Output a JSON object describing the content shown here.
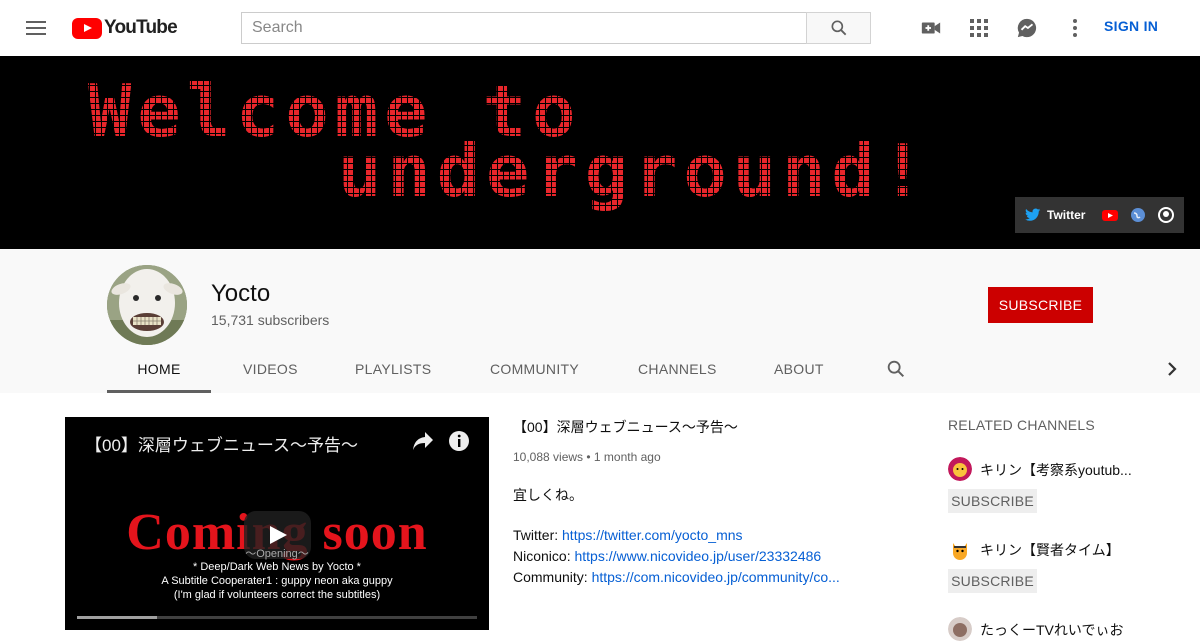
{
  "topbar": {
    "logo_text": "YouTube",
    "search_placeholder": "Search",
    "signin_label": "SIGN IN"
  },
  "banner": {
    "line1": "Welcome to",
    "line2": "underground!",
    "links": [
      {
        "label": "Twitter",
        "icon": "twitter-icon"
      },
      {
        "icon": "youtube-icon"
      },
      {
        "icon": "globe-icon"
      },
      {
        "icon": "github-icon"
      }
    ]
  },
  "channel": {
    "name": "Yocto",
    "subscribers": "15,731 subscribers",
    "subscribe_label": "SUBSCRIBE",
    "tabs": [
      "HOME",
      "VIDEOS",
      "PLAYLISTS",
      "COMMUNITY",
      "CHANNELS",
      "ABOUT"
    ]
  },
  "featured": {
    "player_title": "【00】深層ウェブニュース～予告～",
    "coming_soon": "Coming soon",
    "opening": "～Opening～",
    "subtitle_lines": [
      "* Deep/Dark Web News by Yocto *",
      "A Subtitle Cooperater1 : guppy neon aka guppy",
      "(I'm glad if volunteers correct the subtitles)"
    ],
    "progress": 0.2,
    "title": "【00】深層ウェブニュース～予告～",
    "meta": "10,088 views • 1 month ago",
    "description": "宜しくね。",
    "links": [
      {
        "label": "Twitter: ",
        "url": "https://twitter.com/yocto_mns"
      },
      {
        "label": "Niconico: ",
        "url": "https://www.nicovideo.jp/user/23332486"
      },
      {
        "label": "Community: ",
        "url": "https://com.nicovideo.jp/community/co..."
      }
    ]
  },
  "related": {
    "heading": "RELATED CHANNELS",
    "subscribe_label": "SUBSCRIBE",
    "items": [
      {
        "name": "キリン【考察系youtub...",
        "color": "#c2185b"
      },
      {
        "name": "キリン【賢者タイム】",
        "color": "#f9a825"
      },
      {
        "name": "たっくーTVれいでぃお",
        "color": "#8d6e63"
      }
    ]
  },
  "colors": {
    "brand_red": "#ff0000",
    "subscribe_red": "#cc0000",
    "link_blue": "#065fd4",
    "banner_text": "#e8262b"
  }
}
